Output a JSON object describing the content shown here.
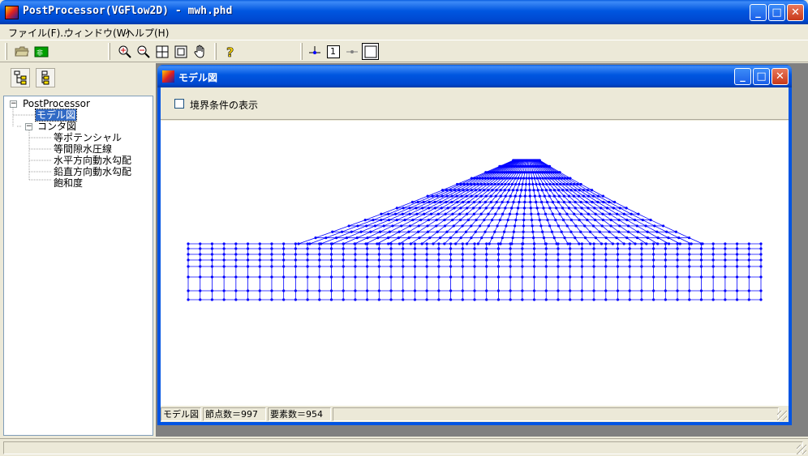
{
  "window": {
    "title": "PostProcessor(VGFlow2D) - mwh.phd"
  },
  "menu": [
    {
      "label": "ファイル(F)..."
    },
    {
      "label": "ウィンドウ(W)"
    },
    {
      "label": "ヘルプ(H)"
    }
  ],
  "toolbar": {
    "icons": [
      "open-folder-icon",
      "exit-icon",
      "zoom-in-icon",
      "zoom-out-icon",
      "zoom-fit-icon",
      "zoom-window-icon",
      "pan-hand-icon",
      "help-icon",
      "node-icon",
      "number-icon",
      "line-icon",
      "frame-icon"
    ],
    "number_label": "1"
  },
  "tree": {
    "root": "PostProcessor",
    "model": "モデル図",
    "contour": "コンタ図",
    "contour_items": [
      "等ポテンシャル",
      "等間隙水圧線",
      "水平方向動水勾配",
      "鉛直方向動水勾配",
      "飽和度"
    ]
  },
  "child": {
    "title": "モデル図",
    "checkbox_label": "境界条件の表示",
    "checkbox_checked": false
  },
  "status": {
    "view": "モデル図",
    "nodes": "節点数＝997",
    "elements": "要素数＝954"
  },
  "mesh": {
    "color": "#0000ff",
    "node_count": 997,
    "element_count": 954
  }
}
